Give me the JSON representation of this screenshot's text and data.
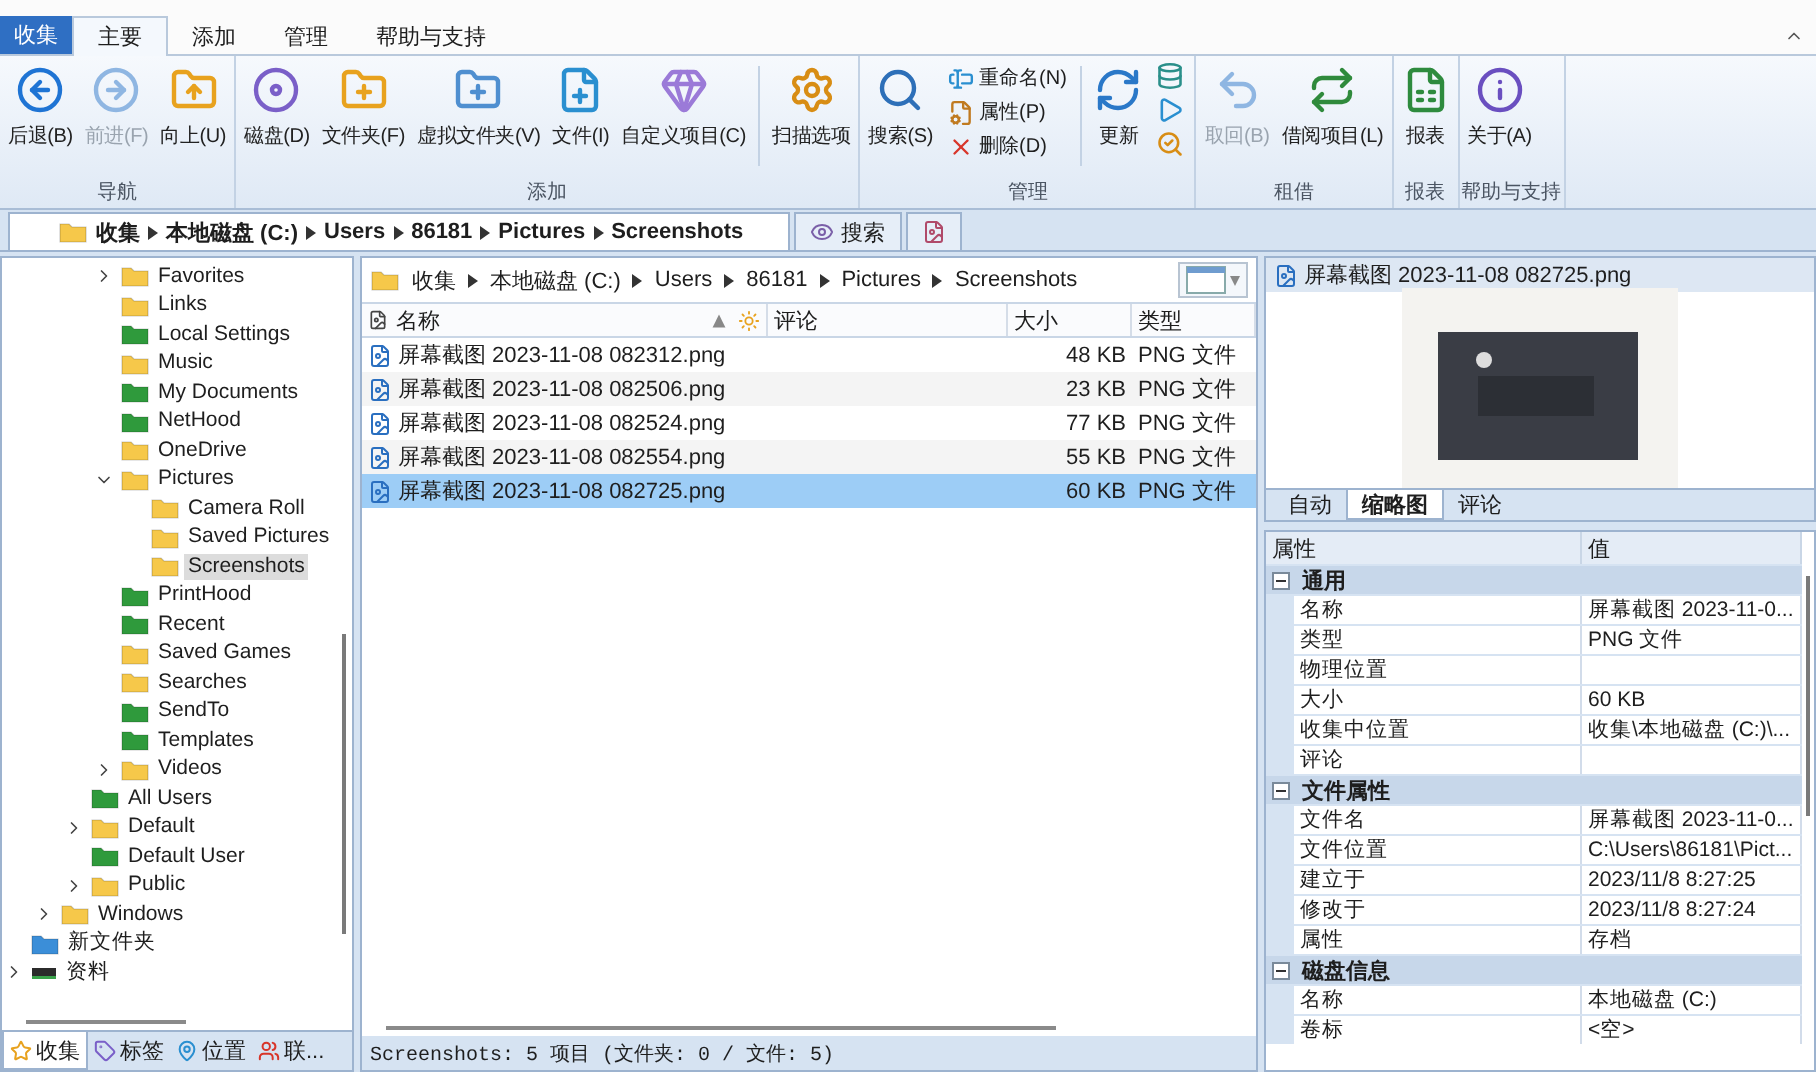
{
  "app_button": {
    "label": "收集"
  },
  "menu_tabs": [
    {
      "label": "主要",
      "kind": "tab",
      "selected": true
    },
    {
      "label": "添加",
      "kind": "tab",
      "selected": false
    },
    {
      "label": "管理",
      "kind": "tab",
      "selected": false
    },
    {
      "label": "帮助与支持",
      "kind": "tab",
      "selected": false
    }
  ],
  "ribbon": {
    "groups": [
      {
        "label": "导航",
        "items": [
          {
            "kind": "large",
            "label": "后退(B)",
            "disabled": false
          },
          {
            "kind": "large",
            "label": "前进(F)",
            "disabled": true
          },
          {
            "kind": "large",
            "label": "向上(U)",
            "disabled": false
          }
        ]
      },
      {
        "label": "添加",
        "items": [
          {
            "kind": "large",
            "label": "磁盘(D)",
            "disabled": false
          },
          {
            "kind": "large",
            "label": "文件夹(F)",
            "disabled": false
          },
          {
            "kind": "large",
            "label": "虚拟文件夹(V)",
            "disabled": false
          },
          {
            "kind": "large",
            "label": "文件(I)",
            "disabled": false
          },
          {
            "kind": "large",
            "label": "自定义项目(C)",
            "disabled": false
          },
          {
            "kind": "separator"
          },
          {
            "kind": "large",
            "label": "扫描选项",
            "disabled": false
          }
        ]
      },
      {
        "label": "管理",
        "items": [
          {
            "kind": "large",
            "label": "搜索(S)",
            "disabled": false
          },
          {
            "kind": "stack",
            "items": [
              {
                "label": "重命名(N)"
              },
              {
                "label": "属性(P)"
              },
              {
                "label": "删除(D)"
              }
            ]
          },
          {
            "kind": "separator"
          },
          {
            "kind": "large",
            "label": "更新",
            "disabled": false
          },
          {
            "kind": "icon-stack"
          }
        ]
      },
      {
        "label": "租借",
        "items": [
          {
            "kind": "large",
            "label": "取回(B)",
            "disabled": true
          },
          {
            "kind": "large",
            "label": "借阅项目(L)",
            "disabled": false
          }
        ]
      },
      {
        "label": "报表",
        "items": [
          {
            "kind": "large",
            "label": "报表",
            "disabled": false
          }
        ]
      },
      {
        "label": "帮助与支持",
        "items": [
          {
            "kind": "large",
            "label": "关于(A)",
            "disabled": false
          }
        ]
      }
    ]
  },
  "doc_tabs": [
    {
      "kind": "path",
      "segments": [
        "收集",
        "本地磁盘 (C:)",
        "Users",
        "86181",
        "Pictures",
        "Screenshots"
      ],
      "selected": true
    },
    {
      "kind": "search",
      "label": "搜索",
      "selected": false
    },
    {
      "kind": "blank",
      "selected": false
    }
  ],
  "tree": {
    "items": [
      {
        "children": [
          {
            "children": [
              {
                "children": [
                  {
                    "label": "Favorites",
                    "kind": "folder",
                    "expanded": false,
                    "selected": false
                  },
                  {
                    "label": "Links",
                    "kind": "folder",
                    "selected": false
                  },
                  {
                    "label": "Local Settings",
                    "kind": "shell",
                    "selected": false
                  },
                  {
                    "label": "Music",
                    "kind": "folder",
                    "selected": false
                  },
                  {
                    "label": "My Documents",
                    "kind": "shell",
                    "selected": false
                  },
                  {
                    "label": "NetHood",
                    "kind": "shell",
                    "selected": false
                  },
                  {
                    "label": "OneDrive",
                    "kind": "folder",
                    "selected": false
                  },
                  {
                    "label": "Pictures",
                    "kind": "folder",
                    "expanded": true,
                    "selected": false,
                    "children": [
                      {
                        "label": "Camera Roll",
                        "kind": "folder",
                        "selected": false
                      },
                      {
                        "label": "Saved Pictures",
                        "kind": "folder",
                        "selected": false
                      },
                      {
                        "label": "Screenshots",
                        "kind": "folder",
                        "selected": true
                      }
                    ]
                  },
                  {
                    "label": "PrintHood",
                    "kind": "shell",
                    "selected": false
                  },
                  {
                    "label": "Recent",
                    "kind": "shell",
                    "selected": false
                  },
                  {
                    "label": "Saved Games",
                    "kind": "folder",
                    "selected": false
                  },
                  {
                    "label": "Searches",
                    "kind": "folder",
                    "selected": false
                  },
                  {
                    "label": "SendTo",
                    "kind": "shell",
                    "selected": false
                  },
                  {
                    "label": "Templates",
                    "kind": "shell",
                    "selected": false
                  },
                  {
                    "label": "Videos",
                    "kind": "folder",
                    "expanded": false,
                    "selected": false
                  }
                ]
              },
              {
                "label": "All Users",
                "kind": "shell",
                "selected": false
              },
              {
                "label": "Default",
                "kind": "folder",
                "expanded": false,
                "selected": false
              },
              {
                "label": "Default User",
                "kind": "shell",
                "selected": false
              },
              {
                "label": "Public",
                "kind": "folder",
                "expanded": false,
                "selected": false
              }
            ]
          },
          {
            "label": "Windows",
            "kind": "folder",
            "expanded": false,
            "selected": false
          }
        ]
      },
      {
        "label": "新文件夹",
        "kind": "virtual",
        "selected": false
      },
      {
        "label": "资料",
        "kind": "drive",
        "expanded": false,
        "selected": false
      }
    ]
  },
  "tree_tabs": [
    {
      "label": "收集",
      "selected": true
    },
    {
      "label": "标签",
      "selected": false
    },
    {
      "label": "位置",
      "selected": false
    },
    {
      "label": "联...",
      "selected": false
    }
  ],
  "list": {
    "breadcrumb": [
      "收集",
      "本地磁盘 (C:)",
      "Users",
      "86181",
      "Pictures",
      "Screenshots"
    ],
    "columns": [
      {
        "label": "名称",
        "sorted": true
      },
      {
        "label": "评论",
        "sorted": false
      },
      {
        "label": "大小",
        "sorted": false
      },
      {
        "label": "类型",
        "sorted": false
      }
    ],
    "rows": [
      {
        "name": "屏幕截图 2023-11-08 082312.png",
        "size": "48 KB",
        "type": "PNG 文件",
        "selected": false
      },
      {
        "name": "屏幕截图 2023-11-08 082506.png",
        "size": "23 KB",
        "type": "PNG 文件",
        "selected": false
      },
      {
        "name": "屏幕截图 2023-11-08 082524.png",
        "size": "77 KB",
        "type": "PNG 文件",
        "selected": false
      },
      {
        "name": "屏幕截图 2023-11-08 082554.png",
        "size": "55 KB",
        "type": "PNG 文件",
        "selected": false
      },
      {
        "name": "屏幕截图 2023-11-08 082725.png",
        "size": "60 KB",
        "type": "PNG 文件",
        "selected": true
      }
    ],
    "status": "Screenshots: 5 项目 (文件夹: 0 / 文件: 5)"
  },
  "preview": {
    "title": "屏幕截图 2023-11-08 082725.png",
    "tabs": [
      {
        "label": "自动",
        "selected": false
      },
      {
        "label": "缩略图",
        "selected": true
      },
      {
        "label": "评论",
        "selected": false
      }
    ]
  },
  "properties": {
    "columns": [
      "属性",
      "值"
    ],
    "categories": [
      {
        "label": "通用",
        "expanded": true,
        "rows": [
          {
            "name": "名称",
            "value": "屏幕截图 2023-11-0..."
          },
          {
            "name": "类型",
            "value": "PNG 文件"
          },
          {
            "name": "物理位置"
          },
          {
            "name": "大小",
            "value": "60 KB"
          },
          {
            "name": "收集中位置",
            "value": "收集\\本地磁盘 (C:)\\..."
          },
          {
            "name": "评论"
          }
        ]
      },
      {
        "label": "文件属性",
        "expanded": true,
        "rows": [
          {
            "name": "文件名",
            "value": "屏幕截图 2023-11-0..."
          },
          {
            "name": "文件位置",
            "value": "C:\\Users\\86181\\Pict..."
          },
          {
            "name": "建立于",
            "value": "2023/11/8 8:27:25"
          },
          {
            "name": "修改于",
            "value": "2023/11/8 8:27:24"
          },
          {
            "name": "属性",
            "value": "存档"
          }
        ]
      },
      {
        "label": "磁盘信息",
        "expanded": true,
        "rows": [
          {
            "name": "名称",
            "value": "本地磁盘 (C:)"
          },
          {
            "name": "卷标",
            "value": "<空>"
          }
        ]
      }
    ]
  }
}
